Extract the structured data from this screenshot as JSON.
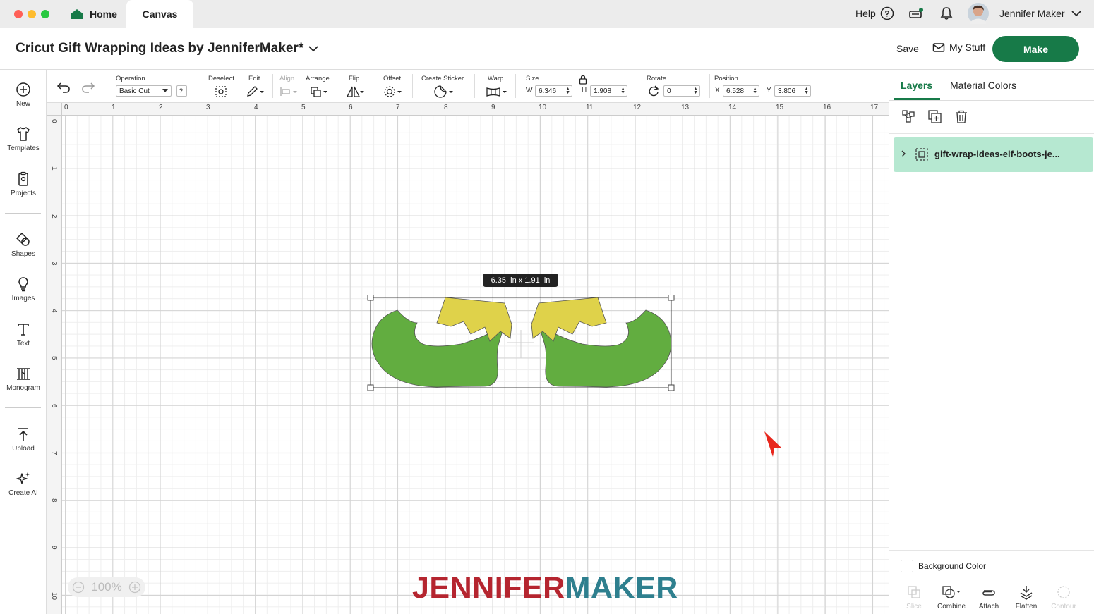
{
  "titlebar": {
    "tabs": [
      {
        "label": "Home"
      },
      {
        "label": "Canvas"
      }
    ],
    "help_label": "Help",
    "user_name": "Jennifer Maker"
  },
  "header": {
    "title": "Cricut Gift Wrapping Ideas by JenniferMaker*",
    "save_label": "Save",
    "mystuff_label": "My Stuff",
    "make_label": "Make"
  },
  "sidebar": {
    "items": [
      {
        "label": "New",
        "icon": "plus-circle-icon"
      },
      {
        "label": "Templates",
        "icon": "shirt-icon"
      },
      {
        "label": "Projects",
        "icon": "clipboard-icon"
      },
      {
        "label": "Shapes",
        "icon": "shapes-icon"
      },
      {
        "label": "Images",
        "icon": "lightbulb-icon"
      },
      {
        "label": "Text",
        "icon": "text-icon"
      },
      {
        "label": "Monogram",
        "icon": "monogram-icon"
      },
      {
        "label": "Upload",
        "icon": "upload-icon"
      },
      {
        "label": "Create AI",
        "icon": "sparkle-icon"
      }
    ]
  },
  "toolbar": {
    "operation_label": "Operation",
    "operation_value": "Basic Cut",
    "deselect_label": "Deselect",
    "edit_label": "Edit",
    "align_label": "Align",
    "arrange_label": "Arrange",
    "flip_label": "Flip",
    "offset_label": "Offset",
    "sticker_label": "Create Sticker",
    "warp_label": "Warp",
    "size_label": "Size",
    "w_label": "W",
    "w_value": "6.346",
    "h_label": "H",
    "h_value": "1.908",
    "rotate_label": "Rotate",
    "rotate_value": "0",
    "position_label": "Position",
    "x_label": "X",
    "x_value": "6.528",
    "y_label": "Y",
    "y_value": "3.806"
  },
  "rulers": {
    "h": [
      "0",
      "1",
      "2",
      "3",
      "4",
      "5",
      "6",
      "7",
      "8",
      "9",
      "10",
      "11",
      "12",
      "13",
      "14",
      "15",
      "16",
      "17"
    ],
    "v": [
      "0",
      "1",
      "2",
      "3",
      "4",
      "5",
      "6",
      "7",
      "8",
      "9",
      "10"
    ]
  },
  "canvas": {
    "size_tooltip": "6.35  in x 1.91  in",
    "zoom_label": "100%",
    "brand_part1": "JENNIFER",
    "brand_part2": "MAKER",
    "colors": {
      "boot_green": "#62ad40",
      "cuff_yellow": "#dfd24a",
      "brand_red": "#b5252f",
      "brand_teal": "#2e7f8e"
    }
  },
  "rightpanel": {
    "tab_layers": "Layers",
    "tab_colors": "Material Colors",
    "layer_name": "gift-wrap-ideas-elf-boots-je...",
    "bg_color_label": "Background Color",
    "tools": [
      {
        "label": "Slice",
        "enabled": false
      },
      {
        "label": "Combine",
        "enabled": true
      },
      {
        "label": "Attach",
        "enabled": true
      },
      {
        "label": "Flatten",
        "enabled": true
      },
      {
        "label": "Contour",
        "enabled": false
      }
    ]
  },
  "accent": "#177a48"
}
